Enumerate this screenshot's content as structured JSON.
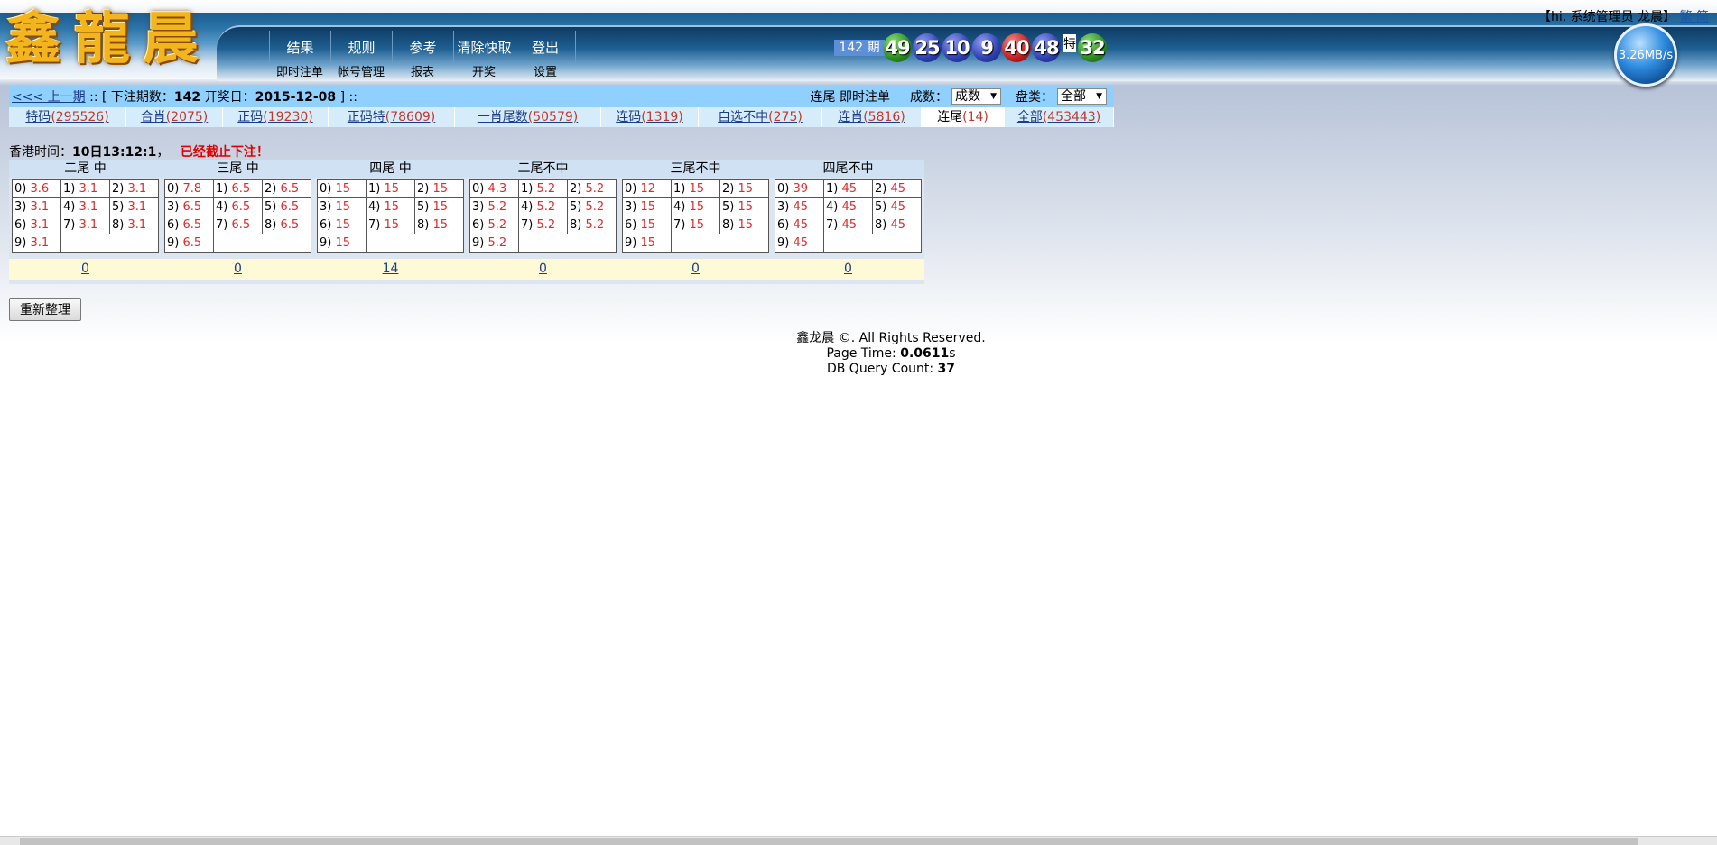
{
  "header": {
    "logo_text": "鑫龍晨",
    "nav_main": [
      "结果",
      "规则",
      "参考",
      "清除快取",
      "登出"
    ],
    "nav_sub": [
      "即时注单",
      "帐号管理",
      "报表",
      "开奖",
      "设置"
    ],
    "period_label": "142 期",
    "balls": [
      {
        "num": "49",
        "color": "green"
      },
      {
        "num": "25",
        "color": "blue"
      },
      {
        "num": "10",
        "color": "blue"
      },
      {
        "num": "9",
        "color": "blue"
      },
      {
        "num": "40",
        "color": "red"
      },
      {
        "num": "48",
        "color": "blue"
      }
    ],
    "special_mark": "特",
    "special_ball": {
      "num": "32",
      "color": "green"
    },
    "user_greeting": "【hi, 系统管理员 龙晨】",
    "lang_link": "繁 简",
    "speed": "3.26MB/s"
  },
  "control_bar": {
    "prev_link": "<<< 上一期",
    "sep1": "::",
    "bet_period_label": "[ 下注期数：",
    "bet_period": "142",
    "draw_date_label": "开奖日：",
    "draw_date": "2015-12-08",
    "close_bracket": "] ::",
    "page_name": "连尾 即时注单",
    "sort_label": "成数：",
    "sort_value": "成数",
    "plate_label": "盘类：",
    "plate_value": "全部"
  },
  "tabs": [
    {
      "label": "特码",
      "count": "(295526)",
      "active": false
    },
    {
      "label": "合肖",
      "count": "(2075)",
      "active": false
    },
    {
      "label": "正码",
      "count": "(19230)",
      "active": false
    },
    {
      "label": "正码特",
      "count": "(78609)",
      "active": false
    },
    {
      "label": "一肖尾数",
      "count": "(50579)",
      "active": false
    },
    {
      "label": "连码",
      "count": "(1319)",
      "active": false
    },
    {
      "label": "自选不中",
      "count": "(275)",
      "active": false
    },
    {
      "label": "连肖",
      "count": "(5816)",
      "active": false
    },
    {
      "label": "连尾",
      "count": "(14)",
      "active": true
    },
    {
      "label": "全部",
      "count": "(453443)",
      "active": false
    }
  ],
  "time_line": {
    "label": "香港时间：",
    "time": "10日13:12:1",
    "comma": "，",
    "closed_msg": "已经截止下注！"
  },
  "grid": {
    "columns": [
      {
        "header": "二尾 中",
        "odds": [
          "3.6",
          "3.1",
          "3.1",
          "3.1",
          "3.1",
          "3.1",
          "3.1",
          "3.1",
          "3.1",
          "3.1"
        ],
        "count": "0"
      },
      {
        "header": "三尾 中",
        "odds": [
          "7.8",
          "6.5",
          "6.5",
          "6.5",
          "6.5",
          "6.5",
          "6.5",
          "6.5",
          "6.5",
          "6.5"
        ],
        "count": "0"
      },
      {
        "header": "四尾 中",
        "odds": [
          "15",
          "15",
          "15",
          "15",
          "15",
          "15",
          "15",
          "15",
          "15",
          "15"
        ],
        "count": "14"
      },
      {
        "header": "二尾不中",
        "odds": [
          "4.3",
          "5.2",
          "5.2",
          "5.2",
          "5.2",
          "5.2",
          "5.2",
          "5.2",
          "5.2",
          "5.2"
        ],
        "count": "0"
      },
      {
        "header": "三尾不中",
        "odds": [
          "12",
          "15",
          "15",
          "15",
          "15",
          "15",
          "15",
          "15",
          "15",
          "15"
        ],
        "count": "0"
      },
      {
        "header": "四尾不中",
        "odds": [
          "39",
          "45",
          "45",
          "45",
          "45",
          "45",
          "45",
          "45",
          "45",
          "45"
        ],
        "count": "0"
      }
    ]
  },
  "reorg_button": "重新整理",
  "footer": {
    "copyright": "鑫龙晨 ©. All Rights Reserved.",
    "page_time_label": "Page Time: ",
    "page_time": "0.0611",
    "page_time_unit": "s",
    "db_query_label": "DB Query Count: ",
    "db_query_count": "37"
  },
  "colors": {
    "ctrl_bar": "#8fd0ff",
    "tab_bar": "#d6ecfb",
    "odds_red": "#e02a2a",
    "closed_red": "#e00000",
    "count_row": "#fffad6"
  }
}
